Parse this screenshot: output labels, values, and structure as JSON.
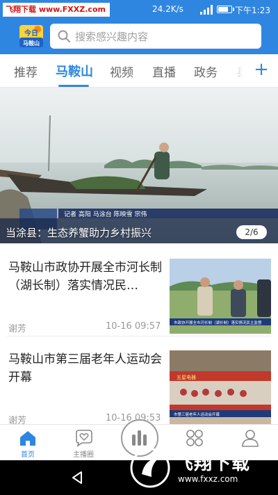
{
  "status_bar": {
    "watermark": "飞翔下载 www.FXXZ.com",
    "speed": "24.2K/s",
    "time": "下午1:23"
  },
  "header": {
    "logo_text": "今日马鞍山",
    "search_placeholder": "搜索感兴趣内容"
  },
  "tabs": {
    "items": [
      "推荐",
      "马鞍山",
      "视频",
      "直播",
      "政务",
      "县"
    ],
    "active": "马鞍山",
    "add_label": "+"
  },
  "hero": {
    "caption": "当涂县：生态养蟹助力乡村振兴",
    "pager": "2/6",
    "overlay_text": "记者 高阳 马涂台 陈映雪 宗伟"
  },
  "news": [
    {
      "title": "马鞍山市政协开展全市河长制（湖长制）落实情况民…",
      "author": "谢芳",
      "time": "10-16 09:57",
      "thumb_caption": "市政协开展全市河长制（湖长制）落实情况民主监督"
    },
    {
      "title": "马鞍山市第三届老年人运动会开幕",
      "author": "谢芳",
      "time": "10-16 09:53",
      "thumb_caption": "市第三届老年人运动会开幕"
    }
  ],
  "bottom_nav": {
    "items": [
      {
        "label": "首页",
        "icon": "home-icon"
      },
      {
        "label": "主播圈",
        "icon": "heart-chat-icon"
      },
      {
        "label": "",
        "icon": "audio-bars-icon"
      },
      {
        "label": "",
        "icon": "services-grid-icon"
      },
      {
        "label": "",
        "icon": "user-icon"
      }
    ]
  },
  "watermark_bottom": {
    "text": "飞翔下载",
    "url": "www.fxxz.com"
  },
  "colors": {
    "brand": "#2f86e0",
    "watermark_red": "#d21414"
  }
}
